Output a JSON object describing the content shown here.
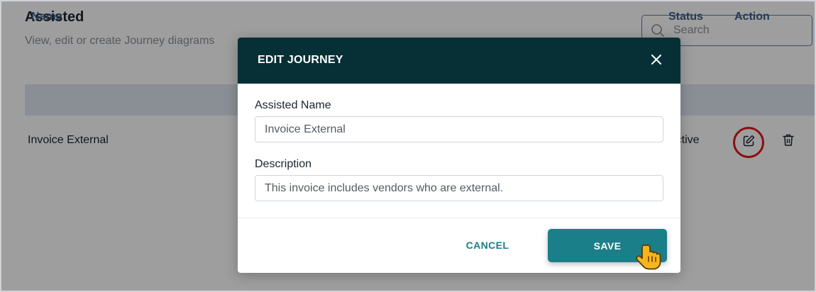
{
  "page": {
    "title": "Assisted",
    "subtitle": "View, edit or create Journey diagrams",
    "search_placeholder": "Search"
  },
  "table": {
    "columns": {
      "name": "Name",
      "status": "Status",
      "action": "Action"
    },
    "rows": [
      {
        "name": "Invoice External",
        "status": "Active"
      }
    ]
  },
  "modal": {
    "title": "EDIT JOURNEY",
    "name_label": "Assisted Name",
    "name_value": "Invoice External",
    "description_label": "Description",
    "description_value": "This invoice includes vendors who are external.",
    "cancel_label": "CANCEL",
    "save_label": "SAVE"
  },
  "colors": {
    "modal_header": "#063036",
    "primary": "#1a7f88",
    "highlight_ring": "#e4141b",
    "table_header_bg": "#dfe7f2",
    "table_header_text": "#3d5f86"
  },
  "icons": {
    "search": "search-icon",
    "edit": "edit-icon",
    "delete": "trash-icon",
    "close": "close-icon",
    "cursor": "hand-pointer-icon"
  }
}
